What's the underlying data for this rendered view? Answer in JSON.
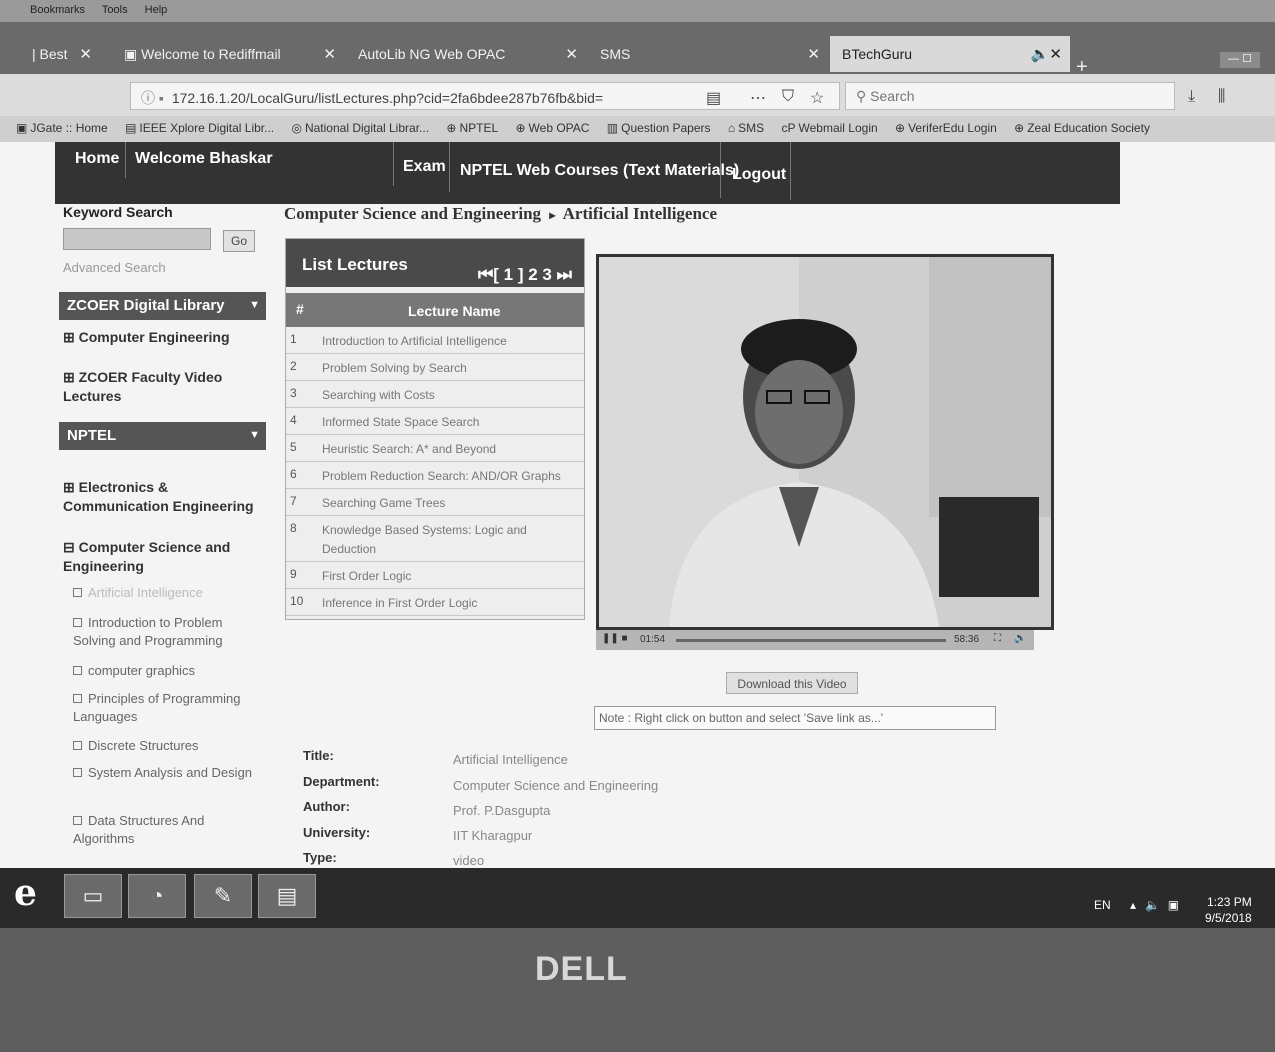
{
  "menubar": {
    "items": [
      "Bookmarks",
      "Tools",
      "Help"
    ]
  },
  "tabs": [
    {
      "label": "| Best"
    },
    {
      "label": "Welcome to Rediffmail"
    },
    {
      "label": "AutoLib NG Web OPAC"
    },
    {
      "label": "SMS"
    },
    {
      "label": "BTechGuru"
    }
  ],
  "address": {
    "url": "172.16.1.20/LocalGuru/listLectures.php?cid=2fa6bdee287b76fb&bid="
  },
  "search": {
    "placeholder": "Search"
  },
  "bookmarks": [
    "JGate :: Home",
    "IEEE Xplore Digital Libr...",
    "National Digital Librar...",
    "NPTEL",
    "Web OPAC",
    "Question Papers",
    "SMS",
    "Webmail Login",
    "VeriferEdu Login",
    "Zeal Education Society"
  ],
  "sitenav": {
    "home": "Home",
    "welcome": "Welcome Bhaskar",
    "exam": "Exam",
    "nptel": "NPTEL Web Courses (Text Materials)",
    "logout": "Logout"
  },
  "sidebar": {
    "keyword_label": "Keyword Search",
    "go": "Go",
    "advanced": "Advanced Search",
    "library_header": "ZCOER Digital Library",
    "library_items": [
      "⊞ Computer Engineering",
      "⊞ ZCOER Faculty Video Lectures"
    ],
    "nptel_header": "NPTEL",
    "nptel_items": [
      "⊞ Electronics & Communication Engineering",
      "⊟ Computer Science and Engineering"
    ],
    "subitems": [
      "Artificial Intelligence",
      "Introduction to Problem Solving and Programming",
      "computer graphics",
      "Principles of Programming Languages",
      "Discrete Structures",
      "System Analysis and Design",
      "Data Structures And Algorithms"
    ]
  },
  "breadcrumb": {
    "parent": "Computer Science and Engineering",
    "sep": "▸",
    "current": "Artificial Intelligence"
  },
  "lectures": {
    "title": "List Lectures",
    "pager": "⏮[ 1 ] 2 3 ⏭",
    "col_num": "#",
    "col_name": "Lecture Name",
    "rows": [
      {
        "num": "1",
        "name": "Introduction to Artificial Intelligence"
      },
      {
        "num": "2",
        "name": "Problem Solving by Search"
      },
      {
        "num": "3",
        "name": "Searching with Costs"
      },
      {
        "num": "4",
        "name": "Informed State Space Search"
      },
      {
        "num": "5",
        "name": "Heuristic Search: A* and Beyond"
      },
      {
        "num": "6",
        "name": "Problem Reduction Search: AND/OR Graphs"
      },
      {
        "num": "7",
        "name": "Searching Game Trees"
      },
      {
        "num": "8",
        "name": "Knowledge Based Systems: Logic and Deduction"
      },
      {
        "num": "9",
        "name": "First Order Logic"
      },
      {
        "num": "10",
        "name": "Inference in First Order Logic"
      }
    ]
  },
  "video": {
    "time_elapsed": "01:54",
    "time_total": "58:36",
    "download": "Download this Video",
    "note": "Note : Right click on button and select 'Save link as...'"
  },
  "meta": [
    {
      "key": "Title:",
      "value": "Artificial Intelligence"
    },
    {
      "key": "Department:",
      "value": "Computer Science and Engineering"
    },
    {
      "key": "Author:",
      "value": "Prof. P.Dasgupta"
    },
    {
      "key": "University:",
      "value": "IIT Kharagpur"
    },
    {
      "key": "Type:",
      "value": "video"
    }
  ],
  "taskbar": {
    "lang": "EN",
    "time": "1:23 PM",
    "date": "9/5/2018"
  },
  "brand": "DELL",
  "icons": {
    "ie": "ie-icon",
    "explorer": "folder-icon",
    "media": "media-icon",
    "paint": "paint-icon",
    "word": "word-icon"
  }
}
